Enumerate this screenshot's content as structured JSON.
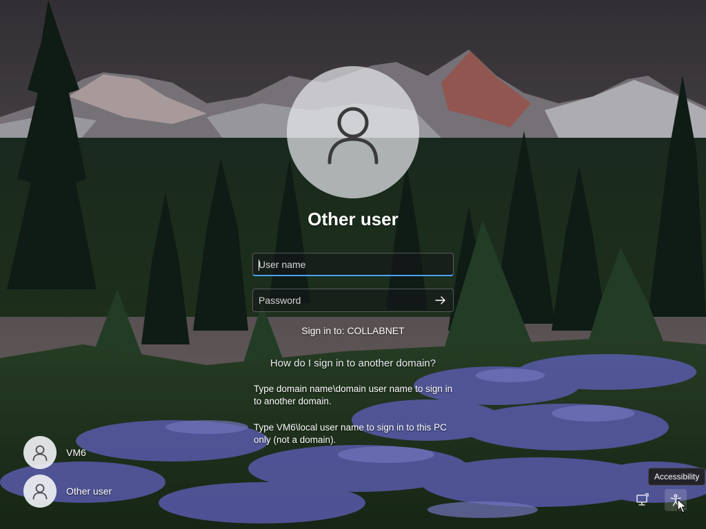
{
  "login": {
    "selected_user": "Other user",
    "username_placeholder": "User name",
    "password_placeholder": "Password",
    "sign_in_to": "Sign in to: COLLABNET",
    "help_link": "How do I sign in to another domain?",
    "help_text_domain": "Type domain name\\domain user name to sign in to another domain.",
    "help_text_local": "Type VM6\\local user name to sign in to this PC only (not a domain)."
  },
  "user_list": [
    {
      "label": "VM6"
    },
    {
      "label": "Other user"
    }
  ],
  "system": {
    "accessibility_tooltip": "Accessibility"
  },
  "icons": {
    "avatar": "person-icon",
    "submit": "arrow-right-icon",
    "network": "network-icon",
    "accessibility": "accessibility-icon"
  },
  "colors": {
    "focus_accent": "#4aa3ff",
    "field_background": "#14161a"
  }
}
